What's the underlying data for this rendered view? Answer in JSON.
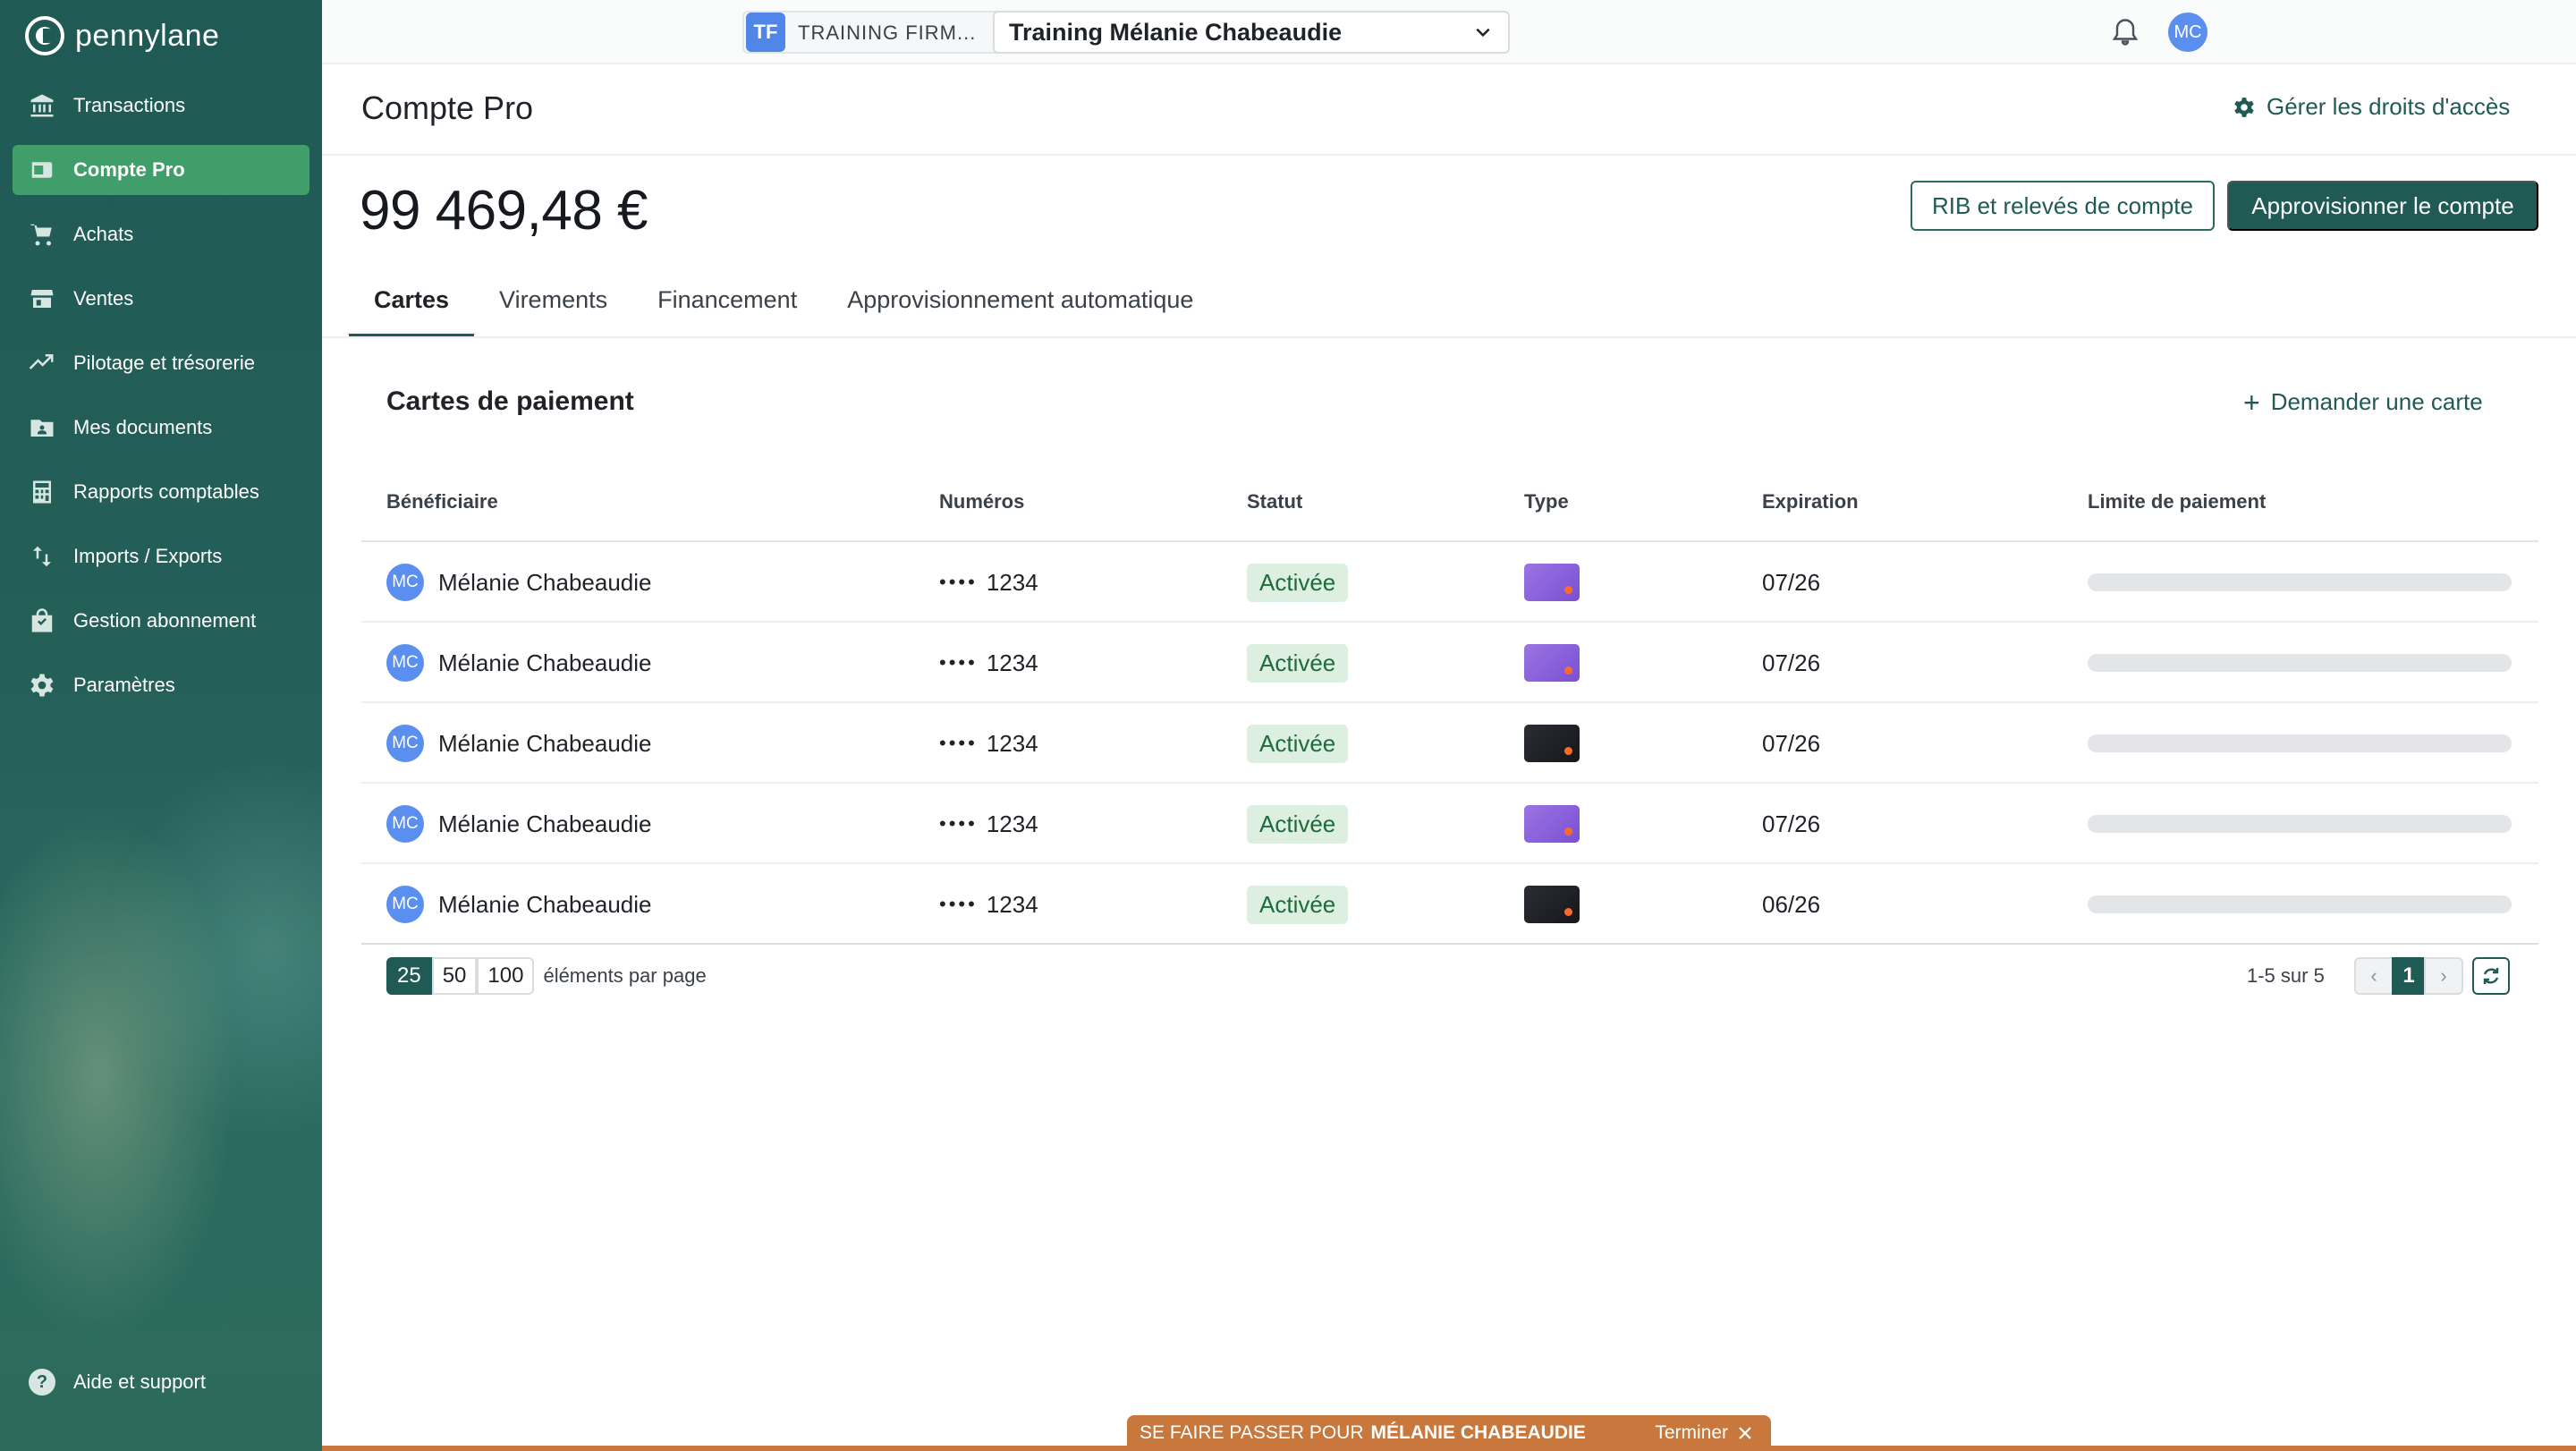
{
  "app": {
    "brand": "pennylane"
  },
  "sidebar": {
    "items": [
      {
        "label": "Transactions",
        "icon": "bank-icon"
      },
      {
        "label": "Compte Pro",
        "icon": "wallet-icon",
        "active": true
      },
      {
        "label": "Achats",
        "icon": "cart-icon"
      },
      {
        "label": "Ventes",
        "icon": "store-icon"
      },
      {
        "label": "Pilotage et trésorerie",
        "icon": "trend-icon"
      },
      {
        "label": "Mes documents",
        "icon": "folder-icon"
      },
      {
        "label": "Rapports comptables",
        "icon": "calculator-icon"
      },
      {
        "label": "Imports / Exports",
        "icon": "import-export-icon"
      },
      {
        "label": "Gestion abonnement",
        "icon": "bag-icon"
      },
      {
        "label": "Paramètres",
        "icon": "gear-icon"
      }
    ],
    "help_label": "Aide et support"
  },
  "topbar": {
    "firm_badge": "TF",
    "firm_name": "TRAINING FIRM...",
    "company": "Training Mélanie Chabeaudie",
    "user_initials": "MC"
  },
  "header": {
    "title": "Compte Pro",
    "access_link": "Gérer les droits d'accès"
  },
  "account": {
    "balance": "99 469,48 €",
    "rib_button": "RIB et relevés de compte",
    "fund_button": "Approvisionner le compte"
  },
  "tabs": [
    "Cartes",
    "Virements",
    "Financement",
    "Approvisionnement automatique"
  ],
  "cards_section": {
    "title": "Cartes de paiement",
    "request_label": "Demander une carte",
    "columns": [
      "Bénéficiaire",
      "Numéros",
      "Statut",
      "Type",
      "Expiration",
      "Limite de paiement"
    ],
    "rows": [
      {
        "initials": "MC",
        "name": "Mélanie Chabeaudie",
        "dots": "••••",
        "number": "1234",
        "status": "Activée",
        "type": "purple",
        "expiration": "07/26"
      },
      {
        "initials": "MC",
        "name": "Mélanie Chabeaudie",
        "dots": "••••",
        "number": "1234",
        "status": "Activée",
        "type": "purple",
        "expiration": "07/26"
      },
      {
        "initials": "MC",
        "name": "Mélanie Chabeaudie",
        "dots": "••••",
        "number": "1234",
        "status": "Activée",
        "type": "black",
        "expiration": "07/26"
      },
      {
        "initials": "MC",
        "name": "Mélanie Chabeaudie",
        "dots": "••••",
        "number": "1234",
        "status": "Activée",
        "type": "purple",
        "expiration": "07/26"
      },
      {
        "initials": "MC",
        "name": "Mélanie Chabeaudie",
        "dots": "••••",
        "number": "1234",
        "status": "Activée",
        "type": "black",
        "expiration": "06/26"
      }
    ]
  },
  "pagination": {
    "page_sizes": [
      "25",
      "50",
      "100"
    ],
    "selected_size": "25",
    "per_page_label": "éléments par page",
    "range": "1-5 sur 5",
    "current_page": "1"
  },
  "impersonation": {
    "prefix": "SE FAIRE PASSER POUR",
    "user": "MÉLANIE CHABEAUDIE",
    "end_label": "Terminer"
  },
  "colors": {
    "brand": "#1f5a54",
    "active_nav": "#3f9e6a",
    "status_bg": "#dcefe0",
    "banner": "#c8783c"
  }
}
